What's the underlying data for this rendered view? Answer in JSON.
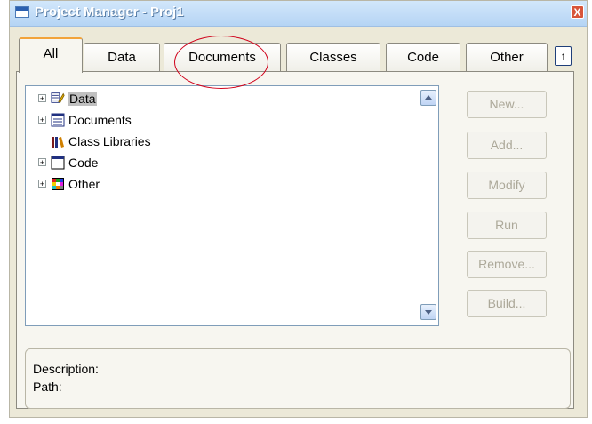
{
  "window": {
    "title": "Project Manager - Proj1",
    "close_label": "X"
  },
  "tabs": [
    {
      "label": "All",
      "active": true
    },
    {
      "label": "Data"
    },
    {
      "label": "Documents"
    },
    {
      "label": "Classes"
    },
    {
      "label": "Code"
    },
    {
      "label": "Other"
    }
  ],
  "pin_label": "↑",
  "tree": {
    "items": [
      {
        "label": "Data",
        "icon": "data-icon",
        "expandable": true,
        "selected": true
      },
      {
        "label": "Documents",
        "icon": "documents-icon",
        "expandable": true
      },
      {
        "label": "Class Libraries",
        "icon": "class-libraries-icon",
        "expandable": false
      },
      {
        "label": "Code",
        "icon": "code-icon",
        "expandable": true
      },
      {
        "label": "Other",
        "icon": "other-icon",
        "expandable": true
      }
    ],
    "expander_symbol": "+"
  },
  "buttons": {
    "new": "New...",
    "add": "Add...",
    "modify": "Modify",
    "run": "Run",
    "remove": "Remove...",
    "build": "Build..."
  },
  "description": {
    "description_label": "Description:",
    "path_label": "Path:"
  },
  "colors": {
    "title_bar": "#b5d4f4",
    "active_tab_accent": "#f2a33a",
    "annotation": "#d0021b",
    "disabled_text": "#aca899"
  }
}
